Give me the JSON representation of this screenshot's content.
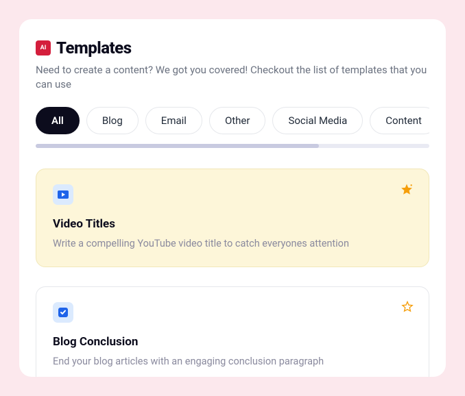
{
  "header": {
    "badge_text": "AI",
    "title": "Templates",
    "subtitle": "Need to create a content? We got you covered! Checkout the list of templates that you can use"
  },
  "tabs": [
    {
      "label": "All",
      "active": true
    },
    {
      "label": "Blog",
      "active": false
    },
    {
      "label": "Email",
      "active": false
    },
    {
      "label": "Other",
      "active": false
    },
    {
      "label": "Social Media",
      "active": false
    },
    {
      "label": "Content",
      "active": false
    }
  ],
  "cards": [
    {
      "title": "Video Titles",
      "description": "Write a compelling YouTube video title to catch everyones attention",
      "featured": true,
      "icon": "video",
      "starred": true
    },
    {
      "title": "Blog Conclusion",
      "description": "End your blog articles with an engaging conclusion paragraph",
      "featured": false,
      "icon": "check",
      "starred": false
    }
  ]
}
